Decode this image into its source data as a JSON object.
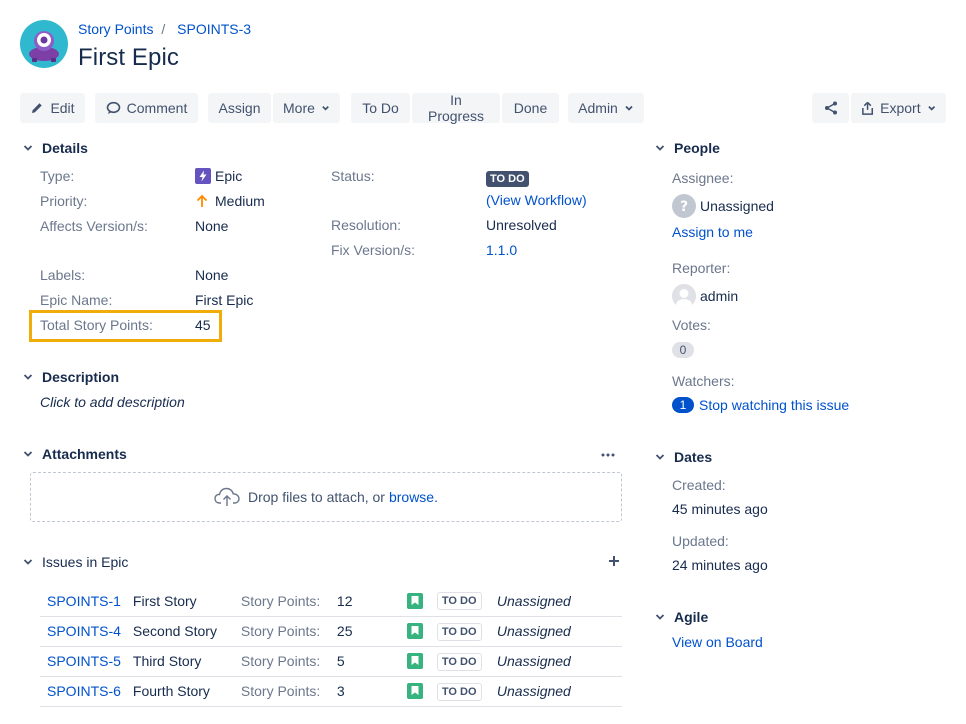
{
  "breadcrumb": {
    "project": "Story Points",
    "separator": "/",
    "issue_key": "SPOINTS-3"
  },
  "issue": {
    "title": "First Epic"
  },
  "toolbar": {
    "edit": "Edit",
    "comment": "Comment",
    "assign": "Assign",
    "more": "More",
    "todo": "To Do",
    "in_progress": "In Progress",
    "done": "Done",
    "admin": "Admin",
    "export": "Export"
  },
  "details": {
    "heading": "Details",
    "type_label": "Type:",
    "type_value": "Epic",
    "priority_label": "Priority:",
    "priority_value": "Medium",
    "affects_label": "Affects Version/s:",
    "affects_value": "None",
    "status_label": "Status:",
    "status_value": "TO DO",
    "view_workflow": "(View Workflow)",
    "resolution_label": "Resolution:",
    "resolution_value": "Unresolved",
    "fix_label": "Fix Version/s:",
    "fix_value": "1.1.0",
    "labels_label": "Labels:",
    "labels_value": "None",
    "epic_name_label": "Epic Name:",
    "epic_name_value": "First Epic",
    "total_sp_label": "Total Story Points:",
    "total_sp_value": "45"
  },
  "description": {
    "heading": "Description",
    "placeholder": "Click to add description"
  },
  "attachments": {
    "heading": "Attachments",
    "drop_text": "Drop files to attach, or",
    "browse": "browse."
  },
  "epic_issues": {
    "heading": "Issues in Epic",
    "rows": [
      {
        "key": "SPOINTS-1",
        "summary": "First Story",
        "sp_label": "Story Points:",
        "sp": "12",
        "status": "TO DO",
        "assignee": "Unassigned"
      },
      {
        "key": "SPOINTS-4",
        "summary": "Second Story",
        "sp_label": "Story Points:",
        "sp": "25",
        "status": "TO DO",
        "assignee": "Unassigned"
      },
      {
        "key": "SPOINTS-5",
        "summary": "Third Story",
        "sp_label": "Story Points:",
        "sp": "5",
        "status": "TO DO",
        "assignee": "Unassigned"
      },
      {
        "key": "SPOINTS-6",
        "summary": "Fourth Story",
        "sp_label": "Story Points:",
        "sp": "3",
        "status": "TO DO",
        "assignee": "Unassigned"
      }
    ]
  },
  "people": {
    "heading": "People",
    "assignee_label": "Assignee:",
    "assignee_value": "Unassigned",
    "assign_to_me": "Assign to me",
    "reporter_label": "Reporter:",
    "reporter_value": "admin",
    "votes_label": "Votes:",
    "votes_count": "0",
    "watchers_label": "Watchers:",
    "watchers_count": "1",
    "stop_watching": "Stop watching this issue"
  },
  "dates": {
    "heading": "Dates",
    "created_label": "Created:",
    "created_value": "45 minutes ago",
    "updated_label": "Updated:",
    "updated_value": "24 minutes ago"
  },
  "agile": {
    "heading": "Agile",
    "view_on_board": "View on Board"
  },
  "colors": {
    "link": "#0052cc",
    "highlight": "#f0ad0a",
    "story_green": "#36b37e",
    "epic_purple": "#6554c0",
    "priority_orange": "#ff8b00"
  }
}
